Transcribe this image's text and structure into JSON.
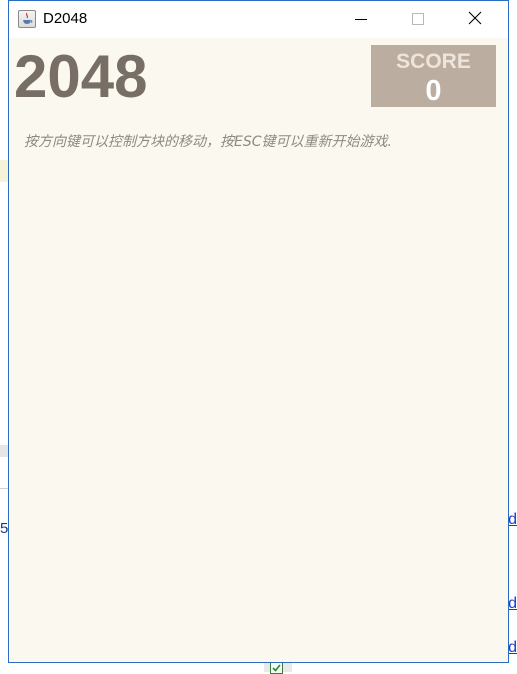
{
  "window": {
    "title": "D2048",
    "controls": {
      "minimize": "minimize-icon",
      "maximize": "maximize-icon",
      "close": "close-icon"
    }
  },
  "game": {
    "title": "2048",
    "score_label": "SCORE",
    "score_value": "0",
    "instructions": "按方向键可以控制方块的移动，按ESC键可以重新开始游戏."
  },
  "background": {
    "left_text": "5",
    "links": [
      "d",
      "d",
      "d"
    ]
  },
  "colors": {
    "title_text": "#776e65",
    "score_box": "#bbada0",
    "score_label": "#eee4da",
    "score_value": "#ffffff",
    "board_background": "#faf8ef",
    "instructions_text": "#8f8a80",
    "window_border": "#2b6cc4"
  }
}
